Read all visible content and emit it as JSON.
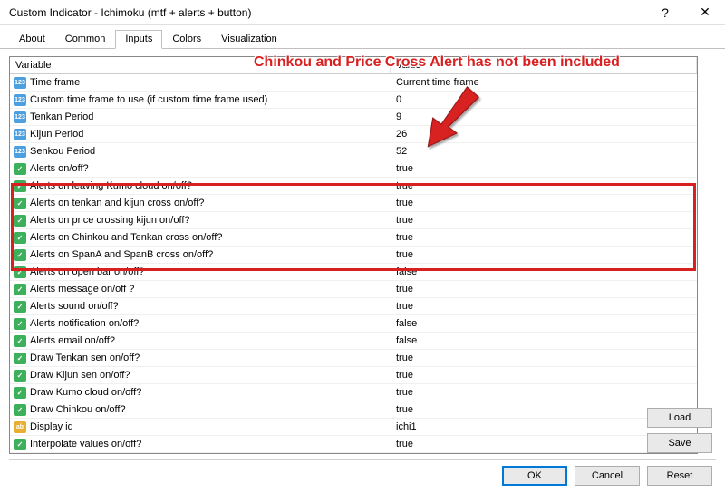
{
  "window": {
    "title": "Custom Indicator - Ichimoku (mtf + alerts + button)"
  },
  "tabs": {
    "items": [
      "About",
      "Common",
      "Inputs",
      "Colors",
      "Visualization"
    ],
    "active": 2
  },
  "columns": {
    "variable": "Variable",
    "value": "Value"
  },
  "annotation": "Chinkou and Price Cross Alert has not been included",
  "rows": [
    {
      "icon": "int",
      "var": "Time frame",
      "val": "Current time frame"
    },
    {
      "icon": "int",
      "var": "Custom time frame to use (if custom time frame used)",
      "val": "0"
    },
    {
      "icon": "int",
      "var": "Tenkan Period",
      "val": "9"
    },
    {
      "icon": "int",
      "var": "Kijun Period",
      "val": "26"
    },
    {
      "icon": "int",
      "var": "Senkou Period",
      "val": "52"
    },
    {
      "icon": "bool",
      "var": "Alerts on/off?",
      "val": "true"
    },
    {
      "icon": "bool",
      "var": "Alerts on leaving Kumo cloud on/off?",
      "val": "true"
    },
    {
      "icon": "bool",
      "var": "Alerts on tenkan and kijun cross on/off?",
      "val": "true"
    },
    {
      "icon": "bool",
      "var": "Alerts on price crossing kijun on/off?",
      "val": "true"
    },
    {
      "icon": "bool",
      "var": "Alerts on Chinkou and Tenkan cross on/off?",
      "val": "true"
    },
    {
      "icon": "bool",
      "var": "Alerts on SpanA and SpanB cross on/off?",
      "val": "true"
    },
    {
      "icon": "bool",
      "var": "Alerts on open bar on/off?",
      "val": "false"
    },
    {
      "icon": "bool",
      "var": "Alerts message on/off ?",
      "val": "true"
    },
    {
      "icon": "bool",
      "var": "Alerts sound on/off?",
      "val": "true"
    },
    {
      "icon": "bool",
      "var": "Alerts notification on/off?",
      "val": "false"
    },
    {
      "icon": "bool",
      "var": "Alerts email on/off?",
      "val": "false"
    },
    {
      "icon": "bool",
      "var": "Draw Tenkan sen on/off?",
      "val": "true"
    },
    {
      "icon": "bool",
      "var": "Draw Kijun sen on/off?",
      "val": "true"
    },
    {
      "icon": "bool",
      "var": "Draw Kumo cloud on/off?",
      "val": "true"
    },
    {
      "icon": "bool",
      "var": "Draw Chinkou on/off?",
      "val": "true"
    },
    {
      "icon": "str",
      "var": "Display id",
      "val": "ichi1"
    },
    {
      "icon": "bool",
      "var": "Interpolate values on/off?",
      "val": "true"
    }
  ],
  "buttons": {
    "load": "Load",
    "save": "Save",
    "ok": "OK",
    "cancel": "Cancel",
    "reset": "Reset"
  }
}
